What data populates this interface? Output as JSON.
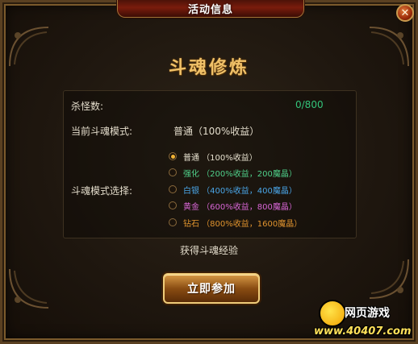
{
  "window": {
    "title": "活动信息",
    "close_label": "✕"
  },
  "content": {
    "heading": "斗魂修炼",
    "kill_count_label": "杀怪数:",
    "kill_count_value": "0/800",
    "current_mode_label": "当前斗魂模式:",
    "current_mode_value": "普通（100%收益）",
    "mode_select_label": "斗魂模式选择:",
    "modes": [
      {
        "label": "普通 （100%收益）",
        "color": "#e8e2d0",
        "selected": true
      },
      {
        "label": "强化 （200%收益，200魔晶）",
        "color": "#4fd08a",
        "selected": false
      },
      {
        "label": "白银 （400%收益，400魔晶）",
        "color": "#4aa6e8",
        "selected": false
      },
      {
        "label": "黄金 （600%收益，800魔晶）",
        "color": "#d866d6",
        "selected": false
      },
      {
        "label": "钻石 （800%收益，1600魔晶）",
        "color": "#e0932e",
        "selected": false
      }
    ],
    "gain_text": "获得斗魂经验",
    "join_button": "立即参加"
  },
  "watermark": {
    "title": "网页游戏",
    "url": "www.40407.com"
  },
  "colors": {
    "accent_gold": "#f0c168",
    "count_green": "#33c47a"
  }
}
